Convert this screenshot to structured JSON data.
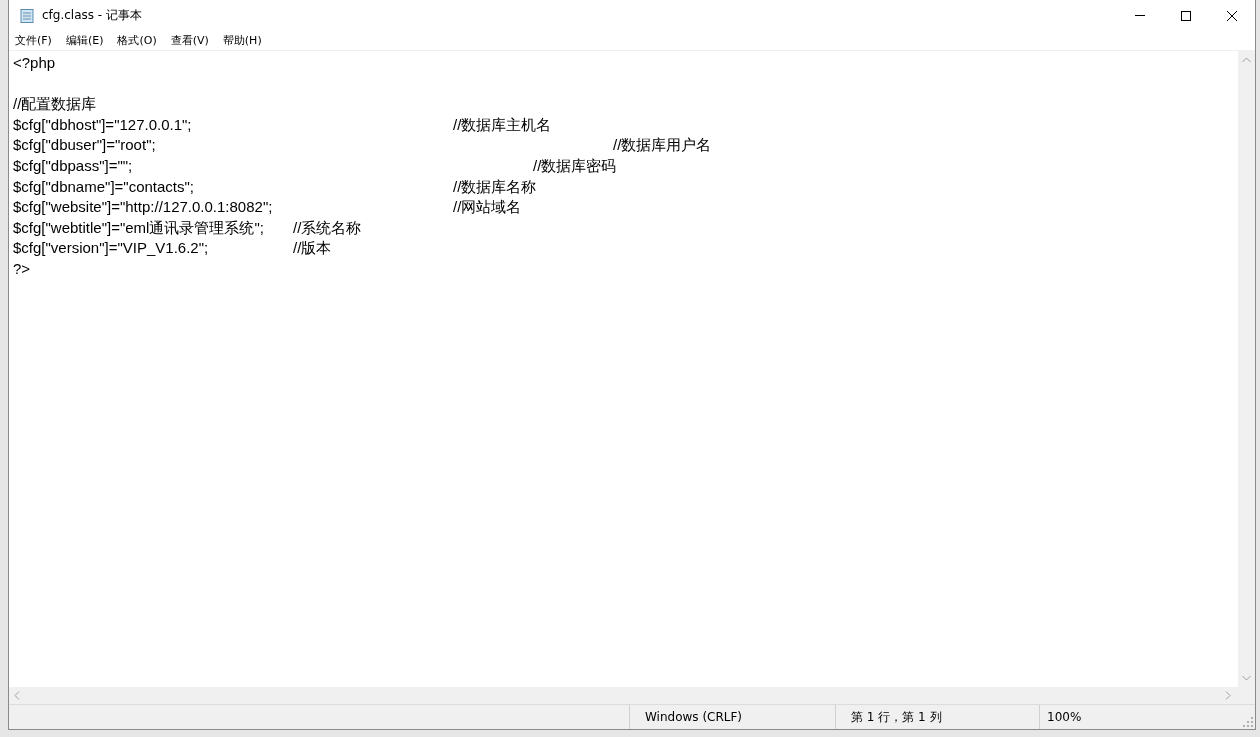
{
  "window": {
    "title": "cfg.class - 记事本"
  },
  "menu": [
    {
      "label": "文件(F)"
    },
    {
      "label": "编辑(E)"
    },
    {
      "label": "格式(O)"
    },
    {
      "label": "查看(V)"
    },
    {
      "label": "帮助(H)"
    }
  ],
  "editor": {
    "lines": [
      {
        "kind": "code",
        "text": "<?php"
      },
      {
        "kind": "blank"
      },
      {
        "kind": "code",
        "text": "//配置数据库"
      },
      {
        "kind": "code",
        "text": "$cfg[\"dbhost\"]=\"127.0.0.1\";\t\t\t\t\t\t\t//数据库主机名"
      },
      {
        "kind": "code",
        "text": "$cfg[\"dbuser\"]=\"root\";\t\t\t\t\t\t\t\t\t\t\t\t//数据库用户名"
      },
      {
        "kind": "code",
        "text": "$cfg[\"dbpass\"]=\"\";\t\t\t\t\t\t\t\t\t\t//数据库密码"
      },
      {
        "kind": "code",
        "text": "$cfg[\"dbname\"]=\"contacts\";\t\t\t\t\t\t\t//数据库名称"
      },
      {
        "kind": "code",
        "text": "$cfg[\"website\"]=\"http://127.0.0.1:8082\";\t\t\t\t\t//网站域名"
      },
      {
        "kind": "code",
        "text": "$cfg[\"webtitle\"]=\"eml通讯录管理系统\";\t//系统名称"
      },
      {
        "kind": "code",
        "text": "$cfg[\"version\"]=\"VIP_V1.6.2\";\t\t\t//版本"
      },
      {
        "kind": "code",
        "text": "?>"
      }
    ]
  },
  "status_bar": {
    "cells": [
      "Windows (CRLF)",
      "第 1 行，第 1 列",
      "100%"
    ]
  }
}
